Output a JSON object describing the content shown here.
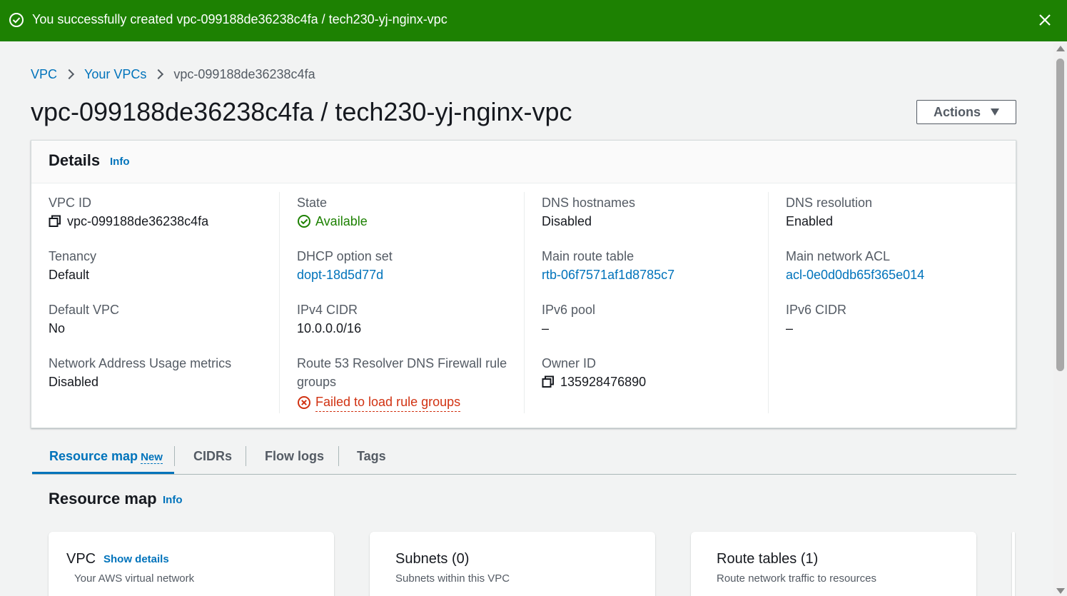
{
  "flash": {
    "message": "You successfully created vpc-099188de36238c4fa / tech230-yj-nginx-vpc",
    "color": "#1d8102"
  },
  "breadcrumb": {
    "items": [
      "VPC",
      "Your VPCs"
    ],
    "current": "vpc-099188de36238c4fa"
  },
  "page": {
    "title": "vpc-099188de36238c4fa / tech230-yj-nginx-vpc",
    "actions_label": "Actions"
  },
  "details": {
    "title": "Details",
    "info": "Info",
    "fields": {
      "vpc_id": {
        "label": "VPC ID",
        "value": "vpc-099188de36238c4fa"
      },
      "state": {
        "label": "State",
        "value": "Available"
      },
      "dns_hostnames": {
        "label": "DNS hostnames",
        "value": "Disabled"
      },
      "dns_resolution": {
        "label": "DNS resolution",
        "value": "Enabled"
      },
      "tenancy": {
        "label": "Tenancy",
        "value": "Default"
      },
      "dhcp": {
        "label": "DHCP option set",
        "value": "dopt-18d5d77d"
      },
      "main_route": {
        "label": "Main route table",
        "value": "rtb-06f7571af1d8785c7"
      },
      "main_acl": {
        "label": "Main network ACL",
        "value": "acl-0e0d0db65f365e014"
      },
      "default_vpc": {
        "label": "Default VPC",
        "value": "No"
      },
      "ipv4": {
        "label": "IPv4 CIDR",
        "value": "10.0.0.0/16"
      },
      "ipv6_pool": {
        "label": "IPv6 pool",
        "value": "–"
      },
      "ipv6_cidr": {
        "label": "IPv6 CIDR",
        "value": "–"
      },
      "nau": {
        "label": "Network Address Usage metrics",
        "value": "Disabled"
      },
      "route53_line1": {
        "label": "Route 53 Resolver DNS Firewall rule"
      },
      "route53_line2": {
        "label": "groups",
        "value": "Failed to load rule groups"
      },
      "owner": {
        "label": "Owner ID",
        "value": "135928476890"
      }
    }
  },
  "tabs": {
    "resource_map": "Resource map",
    "new_badge": "New",
    "cidrs": "CIDRs",
    "flow_logs": "Flow logs",
    "tags": "Tags"
  },
  "resource_map": {
    "title": "Resource map",
    "info": "Info",
    "cards": [
      {
        "title": "VPC",
        "link": "Show details",
        "subtitle": "Your AWS virtual network"
      },
      {
        "title": "Subnets (0)",
        "subtitle": "Subnets within this VPC"
      },
      {
        "title": "Route tables (1)",
        "subtitle": "Route network traffic to resources"
      }
    ]
  }
}
